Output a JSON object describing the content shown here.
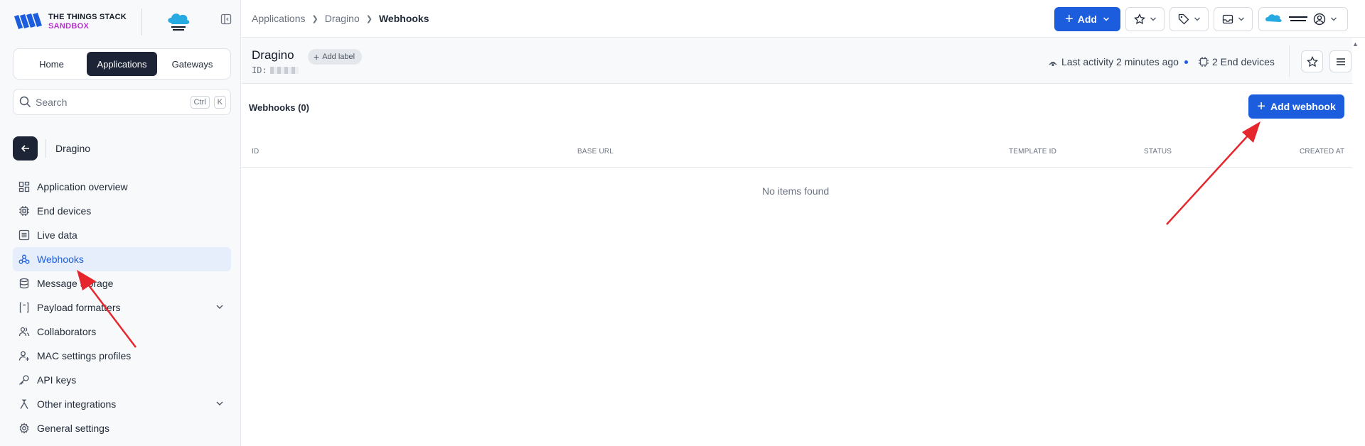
{
  "brand": {
    "line1": "THE THINGS STACK",
    "line2": "SANDBOX",
    "accent": "#1c5dde",
    "sandbox_color": "#b832d1"
  },
  "sidebar": {
    "tabs": [
      {
        "label": "Home",
        "active": false
      },
      {
        "label": "Applications",
        "active": true
      },
      {
        "label": "Gateways",
        "active": false
      }
    ],
    "search": {
      "placeholder": "Search",
      "kbd1": "Ctrl",
      "kbd2": "K"
    },
    "app_name": "Dragino",
    "nav": [
      {
        "label": "Application overview",
        "icon": "grid-icon"
      },
      {
        "label": "End devices",
        "icon": "chip-icon"
      },
      {
        "label": "Live data",
        "icon": "list-icon"
      },
      {
        "label": "Webhooks",
        "icon": "webhook-icon",
        "active": true
      },
      {
        "label": "Message storage",
        "icon": "database-icon"
      },
      {
        "label": "Payload formatters",
        "icon": "code-icon",
        "expandable": true
      },
      {
        "label": "Collaborators",
        "icon": "users-icon"
      },
      {
        "label": "MAC settings profiles",
        "icon": "user-plus-icon"
      },
      {
        "label": "API keys",
        "icon": "key-icon"
      },
      {
        "label": "Other integrations",
        "icon": "integrations-icon",
        "expandable": true
      },
      {
        "label": "General settings",
        "icon": "gear-icon"
      }
    ]
  },
  "header": {
    "breadcrumbs": [
      "Applications",
      "Dragino",
      "Webhooks"
    ],
    "add_label": "Add"
  },
  "app": {
    "title": "Dragino",
    "id_label": "ID:",
    "add_label_text": "Add label",
    "last_activity": "Last activity 2 minutes ago",
    "end_devices": "2 End devices"
  },
  "webhooks": {
    "title": "Webhooks (0)",
    "add_button": "Add webhook",
    "columns": [
      "ID",
      "BASE URL",
      "TEMPLATE ID",
      "STATUS",
      "CREATED AT"
    ],
    "empty": "No items found"
  }
}
